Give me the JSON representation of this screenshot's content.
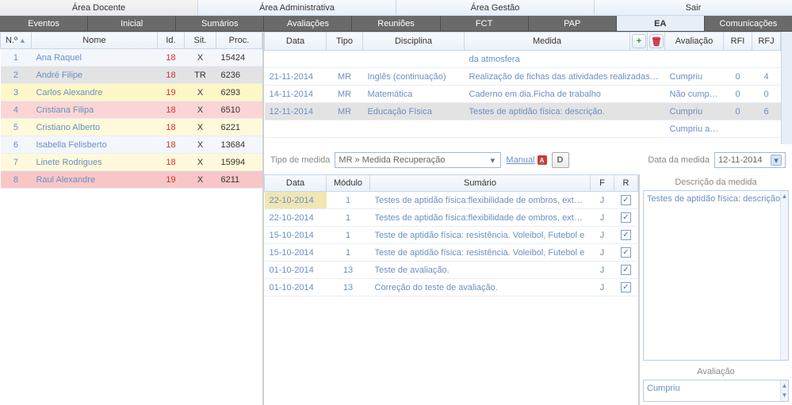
{
  "areas": [
    {
      "label": "Área Docente",
      "active": true
    },
    {
      "label": "Área Administrativa",
      "active": false
    },
    {
      "label": "Área Gestão",
      "active": false
    },
    {
      "label": "Sair",
      "active": false
    }
  ],
  "subnav": [
    {
      "label": "Eventos"
    },
    {
      "label": "Inicial"
    },
    {
      "label": "Sumários"
    },
    {
      "label": "Avaliações"
    },
    {
      "label": "Reuniões"
    },
    {
      "label": "FCT"
    },
    {
      "label": "PAP"
    },
    {
      "label": "EA",
      "active": true
    },
    {
      "label": "Comunicações"
    }
  ],
  "students": {
    "headers": {
      "num": "N.º",
      "nome": "Nome",
      "id": "Id.",
      "sit": "Sit.",
      "proc": "Proc."
    },
    "rows": [
      {
        "n": "1",
        "nome": "Ana Raquel",
        "id": "18",
        "sit": "X",
        "proc": "15424",
        "cls": "row-blue"
      },
      {
        "n": "2",
        "nome": "André Filipe",
        "id": "18",
        "sit": "TR",
        "proc": "6236",
        "cls": "row-grey"
      },
      {
        "n": "3",
        "nome": "Carlos Alexandre",
        "id": "19",
        "sit": "X",
        "proc": "6293",
        "cls": "row-yellow"
      },
      {
        "n": "4",
        "nome": "Cristiana Filipa",
        "id": "18",
        "sit": "X",
        "proc": "6510",
        "cls": "row-pink"
      },
      {
        "n": "5",
        "nome": "Cristiano Alberto",
        "id": "18",
        "sit": "X",
        "proc": "6221",
        "cls": "row-cream"
      },
      {
        "n": "6",
        "nome": "Isabella Felisberto",
        "id": "18",
        "sit": "X",
        "proc": "13684",
        "cls": "row-blue"
      },
      {
        "n": "7",
        "nome": "Linete Rodrigues",
        "id": "18",
        "sit": "X",
        "proc": "15994",
        "cls": "row-cream"
      },
      {
        "n": "8",
        "nome": "Raul Alexandre",
        "id": "19",
        "sit": "X",
        "proc": "6211",
        "cls": "row-red"
      }
    ]
  },
  "measures": {
    "headers": {
      "data": "Data",
      "tipo": "Tipo",
      "disc": "Disciplina",
      "medida": "Medida",
      "aval": "Avaliação",
      "rfi": "RFI",
      "rfj": "RFJ"
    },
    "add_icon_title": "Adicionar",
    "del_icon_title": "Eliminar",
    "rows": [
      {
        "data": "",
        "tipo": "",
        "disc": "",
        "medida": "da atmosfera",
        "aval": "",
        "rfi": "",
        "rfj": ""
      },
      {
        "data": "21-11-2014",
        "tipo": "MR",
        "disc": "Inglês (continuação)",
        "medida": "Realização de fichas das atividades realizadas na aula",
        "aval": "Cumpriu",
        "rfi": "0",
        "rfj": "4"
      },
      {
        "data": "14-11-2014",
        "tipo": "MR",
        "disc": "Matemática",
        "medida": "Caderno em dia.Ficha de trabalho",
        "aval": "Não cumpriu",
        "rfi": "0",
        "rfj": "0"
      },
      {
        "data": "12-11-2014",
        "tipo": "MR",
        "disc": "Educação Física",
        "medida": "Testes de aptidão física: descrição.",
        "aval": "Cumpriu",
        "rfi": "0",
        "rfj": "6",
        "selected": true
      },
      {
        "data": "",
        "tipo": "",
        "disc": "",
        "medida": "",
        "aval": "Cumpriu a med",
        "rfi": "",
        "rfj": ""
      }
    ]
  },
  "toolbar": {
    "tipo_label": "Tipo de medida",
    "tipo_value": "MR » Medida Recuperação",
    "manual_label": "Manual",
    "d_button": "D",
    "data_label": "Data da medida",
    "data_value": "12-11-2014"
  },
  "summaries": {
    "headers": {
      "data": "Data",
      "modulo": "Módulo",
      "sumario": "Sumário",
      "f": "F",
      "r": "R"
    },
    "rows": [
      {
        "data": "22-10-2014",
        "modulo": "1",
        "sumario": "Testes de aptidão física:flexibilidade de ombros, extens",
        "f": "J",
        "r": true,
        "selected": true
      },
      {
        "data": "22-10-2014",
        "modulo": "1",
        "sumario": "Testes de aptidão física:flexibilidade de ombros, extens",
        "f": "J",
        "r": true
      },
      {
        "data": "15-10-2014",
        "modulo": "1",
        "sumario": "Teste de aptidão física: resistência. Voleibol, Futebol e",
        "f": "J",
        "r": true
      },
      {
        "data": "15-10-2014",
        "modulo": "1",
        "sumario": "Teste de aptidão física: resistência. Voleibol, Futebol e",
        "f": "J",
        "r": true
      },
      {
        "data": "01-10-2014",
        "modulo": "13",
        "sumario": "Teste de avaliação.",
        "f": "J",
        "r": true
      },
      {
        "data": "01-10-2014",
        "modulo": "13",
        "sumario": "Correção do teste de avaliação.",
        "f": "J",
        "r": true
      }
    ]
  },
  "side": {
    "desc_label": "Descrição da medida",
    "desc_value": "Testes de aptidão física: descrição.",
    "aval_label": "Avaliação",
    "aval_value": "Cumpriu"
  }
}
